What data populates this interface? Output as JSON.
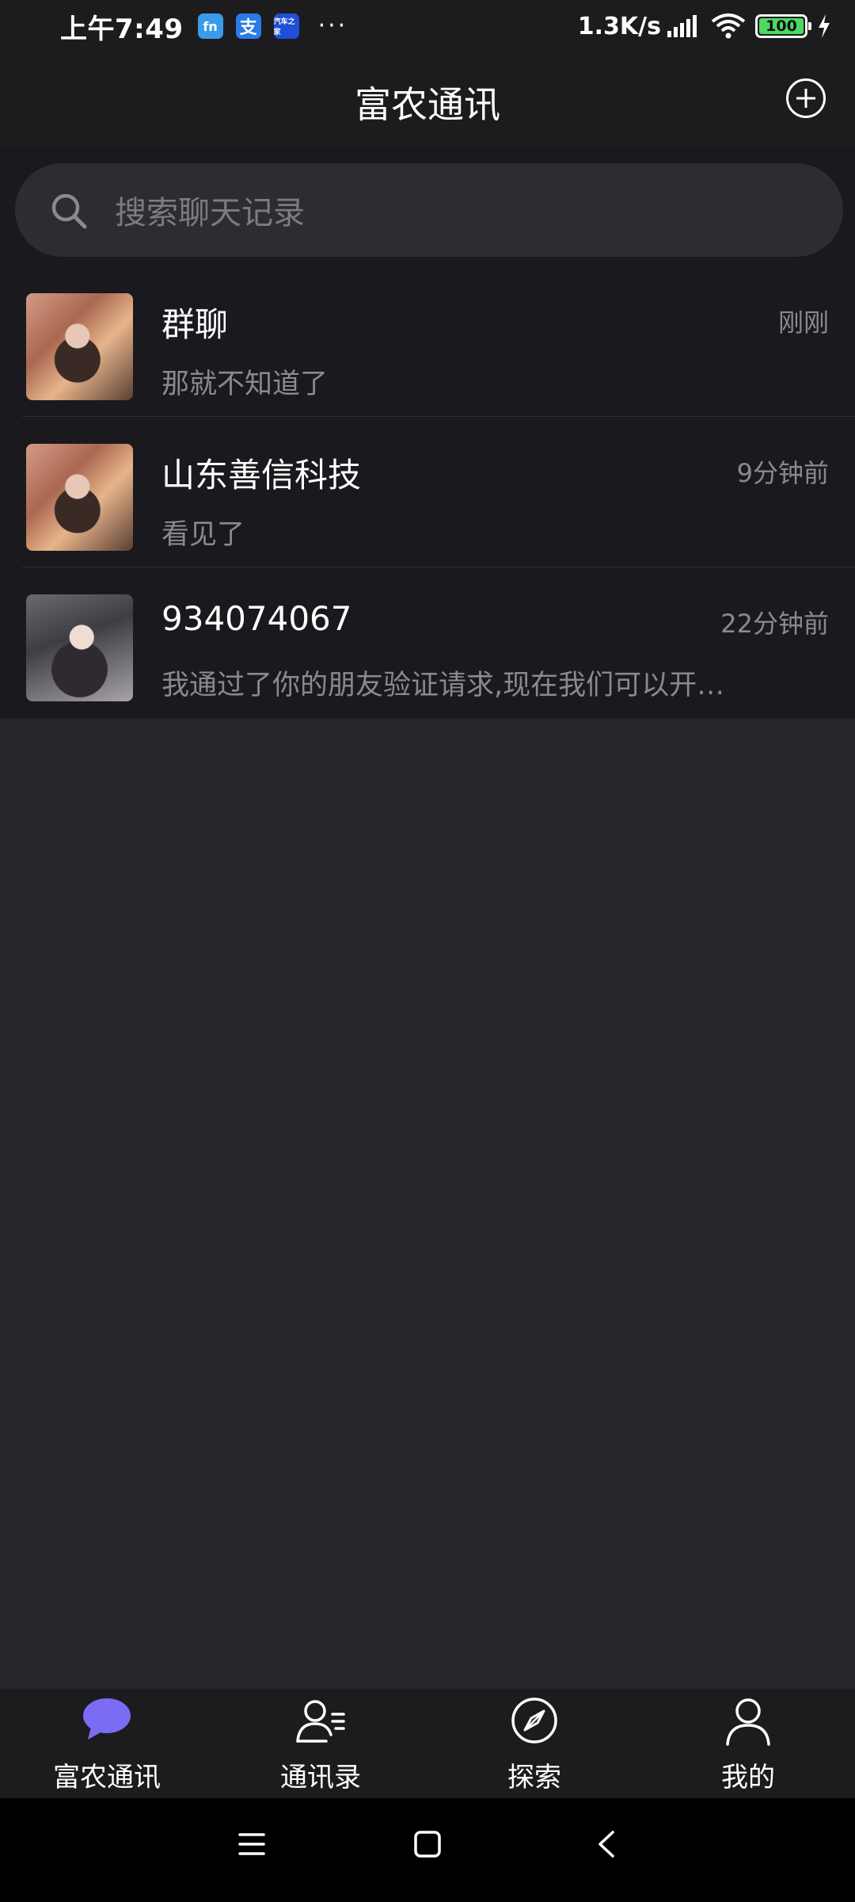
{
  "status_bar": {
    "time": "上午7:49",
    "app_icons": [
      {
        "name": "fn-app-icon",
        "glyph": "fn"
      },
      {
        "name": "alipay-icon",
        "glyph": "支"
      },
      {
        "name": "car-app-icon",
        "glyph": "汽车之家"
      }
    ],
    "more": "···",
    "net_speed": "1.3K/s",
    "battery": "100"
  },
  "header": {
    "title": "富农通讯"
  },
  "search": {
    "placeholder": "搜索聊天记录"
  },
  "chats": [
    {
      "name": "群聊",
      "preview": "那就不知道了",
      "time": "刚刚"
    },
    {
      "name": "山东善信科技",
      "preview": "看见了",
      "time": "9分钟前"
    },
    {
      "name": "934074067",
      "preview": "我通过了你的朋友验证请求,现在我们可以开始聊天了",
      "time": "22分钟前"
    }
  ],
  "bottom_nav": [
    {
      "label": "富农通讯",
      "icon": "chat-bubble-icon",
      "active": true
    },
    {
      "label": "通讯录",
      "icon": "contacts-icon",
      "active": false
    },
    {
      "label": "探索",
      "icon": "compass-icon",
      "active": false
    },
    {
      "label": "我的",
      "icon": "person-icon",
      "active": false
    }
  ],
  "colors": {
    "accent": "#7b6cf6",
    "background": "#26252b",
    "bar": "#1c1c1e",
    "list_bg": "#1a191e",
    "muted_text": "#8a898f"
  }
}
